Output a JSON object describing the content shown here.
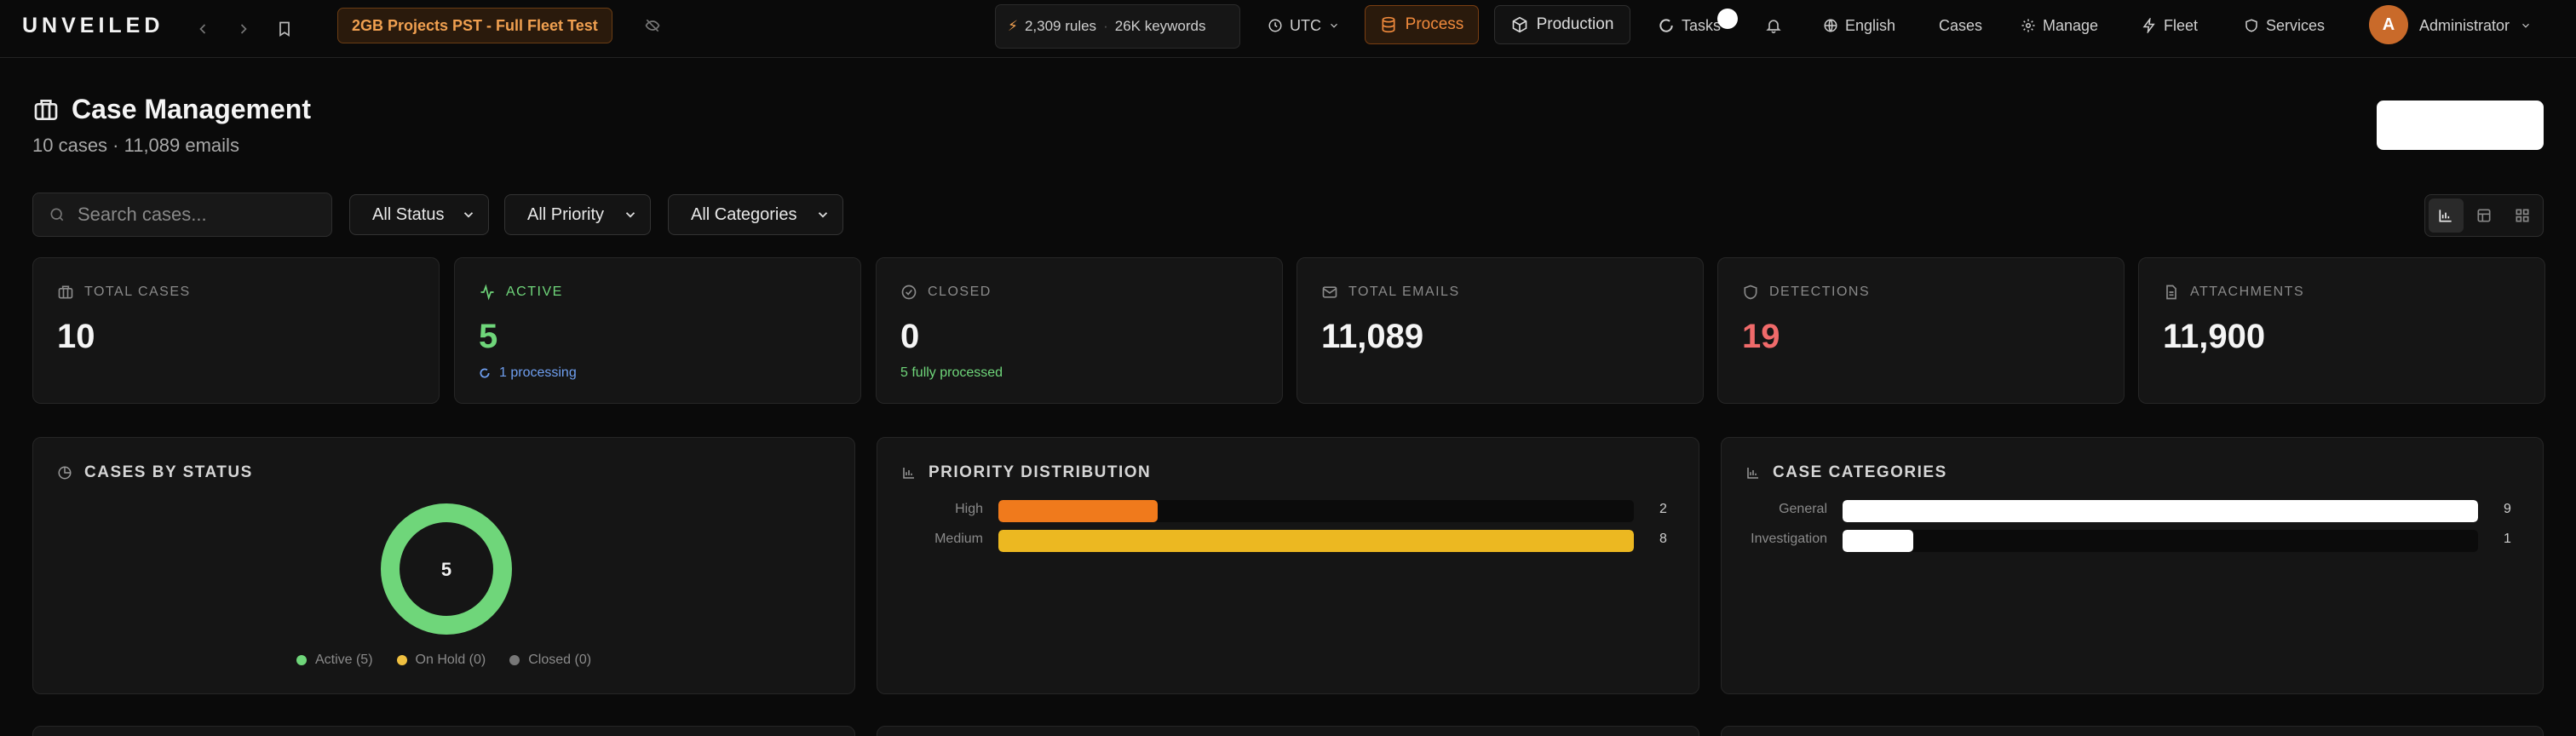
{
  "app": {
    "logo": "UNVEILED"
  },
  "topbar": {
    "project": "2GB Projects PST - Full Fleet Test",
    "rules": "2,309 rules",
    "keywords": "26K keywords",
    "timezone": "UTC",
    "process_label": "Process",
    "production_label": "Production",
    "tasks_label": "Tasks",
    "language": "English",
    "cases_label": "Cases",
    "manage_label": "Manage",
    "fleet_label": "Fleet",
    "services_label": "Services",
    "user_initial": "A",
    "user_name": "Administrator"
  },
  "header": {
    "title": "Case Management",
    "subtitle": "10 cases · 11,089 emails"
  },
  "filters": {
    "search_placeholder": "Search cases...",
    "status": "All Status",
    "priority": "All Priority",
    "categories": "All Categories"
  },
  "stats": [
    {
      "label": "TOTAL CASES",
      "value": "10"
    },
    {
      "label": "ACTIVE",
      "value": "5",
      "sub": "1 processing"
    },
    {
      "label": "CLOSED",
      "value": "0",
      "sub": "5 fully processed"
    },
    {
      "label": "TOTAL EMAILS",
      "value": "11,089"
    },
    {
      "label": "DETECTIONS",
      "value": "19"
    },
    {
      "label": "ATTACHMENTS",
      "value": "11,900"
    }
  ],
  "panels": {
    "status": {
      "title": "CASES BY STATUS",
      "center": "5",
      "legend": [
        {
          "label": "Active (5)",
          "color": "#6fd67a"
        },
        {
          "label": "On Hold (0)",
          "color": "#f0c040"
        },
        {
          "label": "Closed (0)",
          "color": "#777777"
        }
      ],
      "active_fraction": 1.0
    },
    "priority": {
      "title": "PRIORITY DISTRIBUTION",
      "max": 8,
      "rows": [
        {
          "label": "High",
          "value": 2,
          "display": "2",
          "color": "#f07a1c"
        },
        {
          "label": "Medium",
          "value": 8,
          "display": "8",
          "color": "#ecb821"
        }
      ]
    },
    "categories": {
      "title": "CASE CATEGORIES",
      "max": 9,
      "rows": [
        {
          "label": "General",
          "value": 9,
          "display": "9",
          "color": "#ffffff"
        },
        {
          "label": "Investigation",
          "value": 1,
          "display": "1",
          "color": "#ffffff"
        }
      ]
    }
  },
  "colors": {
    "accent_orange": "#f08a3c",
    "active_green": "#6fd67a",
    "detections_red": "#f06a6a",
    "processing_blue": "#6f9ff0"
  }
}
